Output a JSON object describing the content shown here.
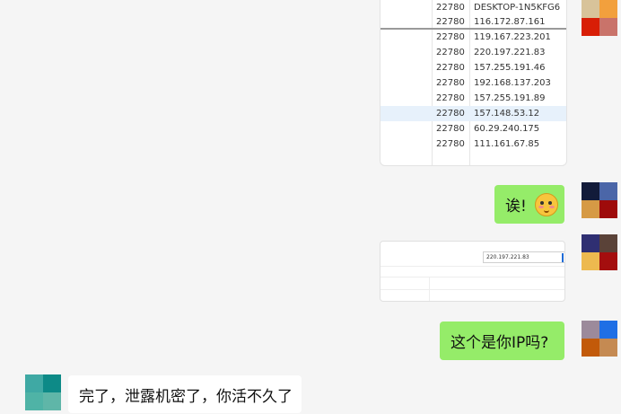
{
  "table": {
    "rows": [
      {
        "port": "22780",
        "addr": "DESKTOP-1N5KFG6"
      },
      {
        "port": "22780",
        "addr": "116.172.87.161"
      },
      {
        "port": "22780",
        "addr": "119.167.223.201"
      },
      {
        "port": "22780",
        "addr": "220.197.221.83"
      },
      {
        "port": "22780",
        "addr": "157.255.191.46"
      },
      {
        "port": "22780",
        "addr": "192.168.137.203"
      },
      {
        "port": "22780",
        "addr": "157.255.191.89"
      },
      {
        "port": "22780",
        "addr": "157.148.53.12"
      },
      {
        "port": "22780",
        "addr": "60.29.240.175"
      },
      {
        "port": "22780",
        "addr": "111.161.67.85"
      }
    ]
  },
  "messages": {
    "sent_1": "诶!",
    "sent_1_emoji": "😳",
    "sent_2": "这个是你IP吗?",
    "received_1": "完了，泄露机密了，你活不久了"
  },
  "form_image": {
    "ip_value": "220.197.221.83",
    "top_hint": "",
    "row1_label": "",
    "row1_value": "",
    "row2_label": "",
    "row2_value": ""
  },
  "colors": {
    "sent_bubble": "#95ec69",
    "received_bubble": "#ffffff",
    "highlight_row": "#e7f1fb"
  }
}
